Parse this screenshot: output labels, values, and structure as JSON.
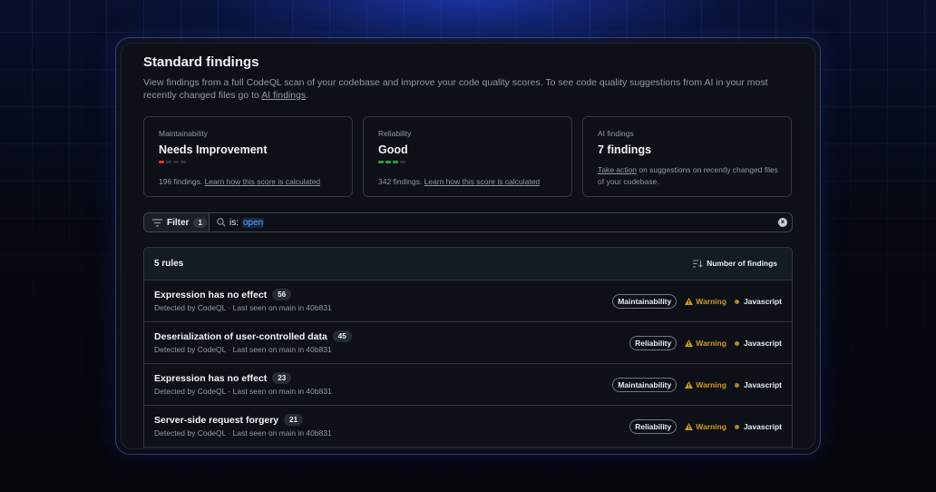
{
  "header": {
    "title": "Standard findings",
    "description_pre": "View findings from a full CodeQL scan of your codebase and improve your code quality scores. To see code quality suggestions from AI in your most recently changed files go to ",
    "description_link": "AI findings",
    "description_post": "."
  },
  "cards": [
    {
      "label": "Maintainability",
      "value": "Needs Improvement",
      "score_level": 1,
      "score_max": 4,
      "bar_color": "#da3633",
      "findings": "196 findings.",
      "link": "Learn how this score is calculated"
    },
    {
      "label": "Reliability",
      "value": "Good",
      "score_level": 3,
      "score_max": 4,
      "bar_color": "#2ea043",
      "findings": "342 findings.",
      "link": "Learn how this score is calculated"
    },
    {
      "label": "AI findings",
      "value": "7 findings",
      "note_link": "Take action",
      "note_text": " on suggestions on recently changed files of your codebase."
    }
  ],
  "filter": {
    "label": "Filter",
    "count": "1",
    "query_key": "is:",
    "query_value": "open"
  },
  "table": {
    "count_label": "5 rules",
    "sort_label": "Number of findings",
    "rows": [
      {
        "name": "Expression has no effect",
        "count": "56",
        "meta": "Detected by CodeQL · Last seen on main in 40b831",
        "tag": "Maintainability",
        "severity": "Warning",
        "language": "Javascript"
      },
      {
        "name": "Deserialization of user-controlled data",
        "count": "45",
        "meta": "Detected by CodeQL · Last seen on main in 40b831",
        "tag": "Reliability",
        "severity": "Warning",
        "language": "Javascript"
      },
      {
        "name": "Expression has no effect",
        "count": "23",
        "meta": "Detected by CodeQL · Last seen on main in 40b831",
        "tag": "Maintainability",
        "severity": "Warning",
        "language": "Javascript"
      },
      {
        "name": "Server-side request forgery",
        "count": "21",
        "meta": "Detected by CodeQL · Last seen on main in 40b831",
        "tag": "Reliability",
        "severity": "Warning",
        "language": "Javascript"
      }
    ]
  },
  "colors": {
    "accent": "#58a6ff",
    "warning": "#d29922",
    "javascript_dot": "#a68a2b"
  }
}
